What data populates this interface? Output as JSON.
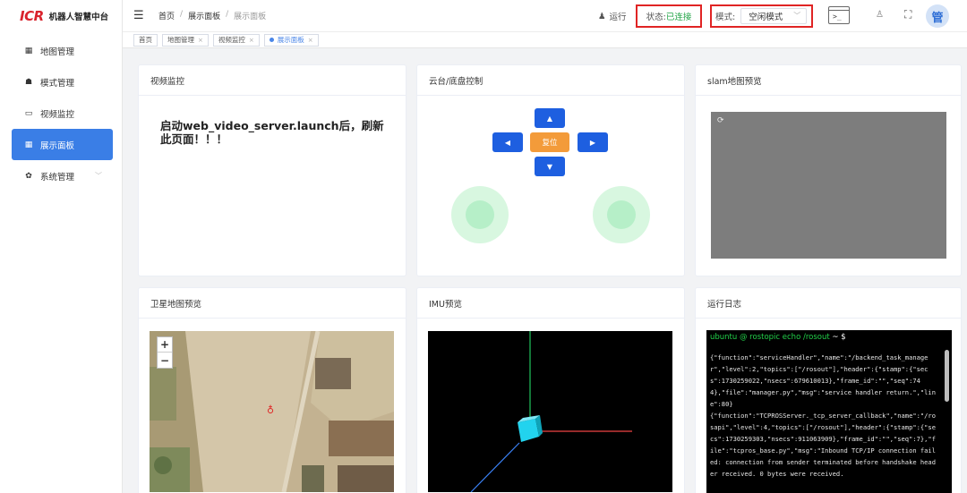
{
  "app": {
    "logo_mark": "ICR",
    "logo_text": "机器人智慧中台"
  },
  "sidebar": {
    "items": [
      {
        "label": "地图管理",
        "icon": "map-icon"
      },
      {
        "label": "模式管理",
        "icon": "mode-icon"
      },
      {
        "label": "视频监控",
        "icon": "video-icon"
      },
      {
        "label": "展示面板",
        "icon": "grid-icon",
        "active": true
      },
      {
        "label": "系统管理",
        "icon": "settings-icon"
      }
    ]
  },
  "header": {
    "breadcrumb": [
      "首页",
      "展示面板",
      "展示面板"
    ],
    "run_label": "运行",
    "status_label": "状态:",
    "status_value": "已连接",
    "mode_label": "模式:",
    "mode_value": "空闲模式",
    "avatar_text": "管"
  },
  "tags": [
    {
      "label": "首页"
    },
    {
      "label": "地图管理"
    },
    {
      "label": "视频监控"
    },
    {
      "label": "展示面板",
      "active": true
    }
  ],
  "cards": {
    "video": {
      "title": "视频监控",
      "message": "启动web_video_server.launch后，刷新此页面！！！"
    },
    "ptz": {
      "title": "云台/底盘控制",
      "reset_label": "复位"
    },
    "slam": {
      "title": "slam地图预览"
    },
    "satellite": {
      "title": "卫星地图预览",
      "zoom_in": "+",
      "zoom_out": "−"
    },
    "imu": {
      "title": "IMU预览"
    },
    "log": {
      "title": "运行日志",
      "prompt_user": "ubuntu @ rostopic echo /rosout",
      "prompt_tail": " ~ $",
      "text": "{\"function\":\"serviceHandler\",\"name\":\"/backend_task_manager\",\"level\":2,\"topics\":[\"/rosout\"],\"header\":{\"stamp\":{\"secs\":1730259022,\"nsecs\":679610013},\"frame_id\":\"\",\"seq\":744},\"file\":\"manager.py\",\"msg\":\"service handler return.\",\"line\":80}\n{\"function\":\"TCPROSServer._tcp_server_callback\",\"name\":\"/rosapi\",\"level\":4,\"topics\":[\"/rosout\"],\"header\":{\"stamp\":{\"secs\":1730259303,\"nsecs\":911063909},\"frame_id\":\"\",\"seq\":7},\"file\":\"tcpros_base.py\",\"msg\":\"Inbound TCP/IP connection failed: connection from sender terminated before handshake header received. 0 bytes were received."
    }
  },
  "colors": {
    "accent": "#3a7ee6",
    "status_ok": "#22a447",
    "highlight_box": "#e02424",
    "ptz_button": "#1e5fe0",
    "reset_button": "#f39b3a"
  }
}
